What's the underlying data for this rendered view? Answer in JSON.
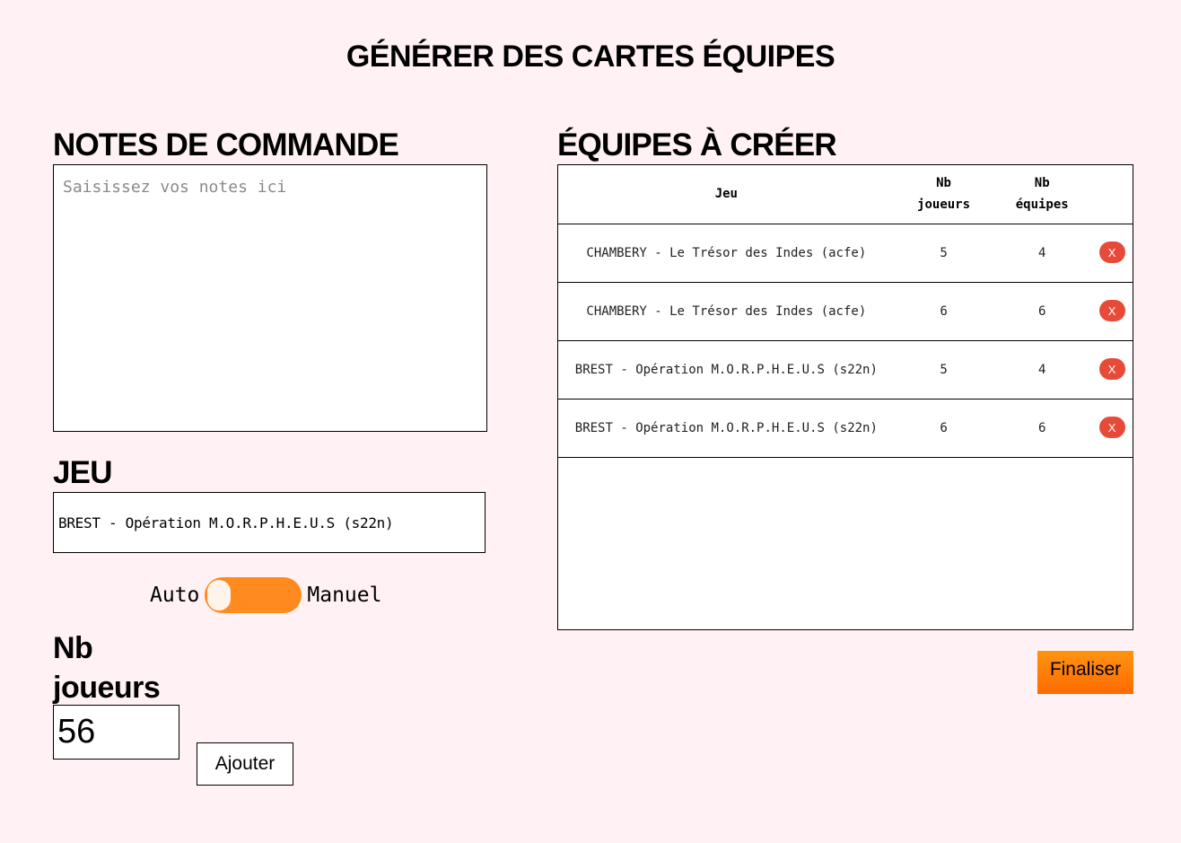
{
  "page": {
    "title": "GÉNÉRER DES CARTES ÉQUIPES"
  },
  "notes": {
    "title": "NOTES DE COMMANDE",
    "placeholder": "Saisissez vos notes ici",
    "value": ""
  },
  "game": {
    "title": "JEU",
    "selected": "BREST - Opération M.O.R.P.H.E.U.S (s22n)"
  },
  "mode_toggle": {
    "left_label": "Auto",
    "right_label": "Manuel",
    "state": "Auto"
  },
  "players": {
    "title_line1": "Nb",
    "title_line2": "joueurs",
    "value": "56",
    "add_label": "Ajouter"
  },
  "teams": {
    "title": "ÉQUIPES À CRÉER",
    "headers": {
      "jeu": "Jeu",
      "nb_joueurs_line1": "Nb",
      "nb_joueurs_line2": "joueurs",
      "nb_equipes_line1": "Nb",
      "nb_equipes_line2": "équipes"
    },
    "rows": [
      {
        "jeu": "CHAMBERY - Le Trésor des Indes (acfe)",
        "nb_joueurs": "5",
        "nb_equipes": "4",
        "delete_label": "X"
      },
      {
        "jeu": "CHAMBERY - Le Trésor des Indes (acfe)",
        "nb_joueurs": "6",
        "nb_equipes": "6",
        "delete_label": "X"
      },
      {
        "jeu": "BREST - Opération M.O.R.P.H.E.U.S (s22n)",
        "nb_joueurs": "5",
        "nb_equipes": "4",
        "delete_label": "X"
      },
      {
        "jeu": "BREST - Opération M.O.R.P.H.E.U.S (s22n)",
        "nb_joueurs": "6",
        "nb_equipes": "6",
        "delete_label": "X"
      }
    ]
  },
  "finalize": {
    "label": "Finaliser"
  },
  "colors": {
    "background": "#fff1f4",
    "toggle": "#ff8a1f",
    "delete": "#e84a3a",
    "finalize_top": "#ff9410",
    "finalize_bottom": "#ff6a00"
  }
}
